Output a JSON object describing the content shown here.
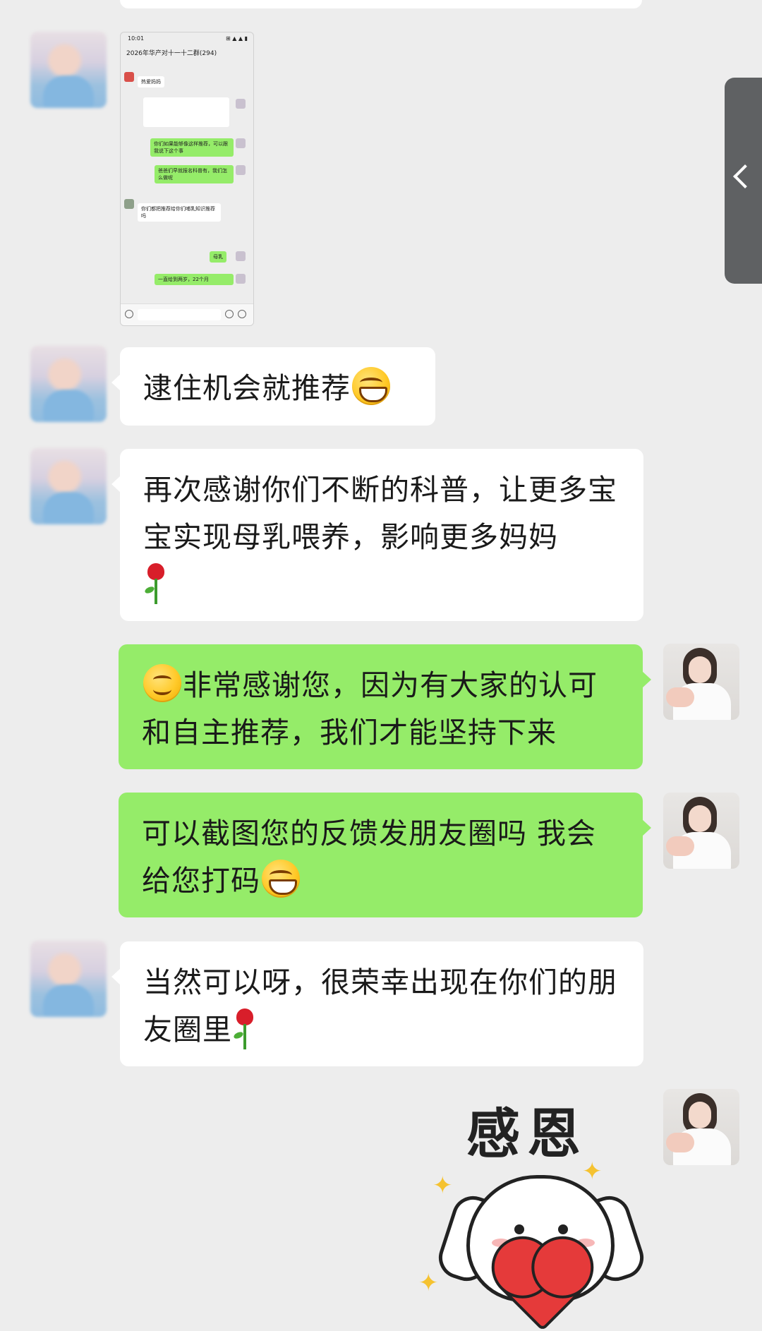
{
  "chat": {
    "thumbnail": {
      "status_time": "10:01",
      "status_right": "⊞ ▲ ▲ ▮",
      "title": "2026年华产对十一十二群(294)",
      "lines": [
        "热爱妈妈",
        "你们如果能够像这样推荐，可以跟我说下这个事",
        "爸爸们早就报名科普有，我们怎么做呢",
        "你们都把推荐给你们哺乳知识推荐吗",
        "母乳",
        "一直给到两岁，22个月"
      ]
    },
    "messages": [
      {
        "text": "逮住机会就推荐"
      },
      {
        "text": "再次感谢你们不断的科普，让更多宝宝实现母乳喂养，影响更多妈妈"
      },
      {
        "text": "非常感谢您，因为有大家的认可和自主推荐，我们才能坚持下来"
      },
      {
        "text": "可以截图您的反馈发朋友圈吗 我会给您打码"
      },
      {
        "text": "当然可以呀，很荣幸出现在你们的朋友圈里"
      }
    ],
    "sticker": {
      "text": "感恩"
    }
  },
  "colors": {
    "background": "#ededed",
    "incoming_bubble": "#ffffff",
    "outgoing_bubble": "#95ec69",
    "side_handle": "#5f6163"
  },
  "icons": {
    "side_handle": "chevron-left-icon",
    "emoji_1": "laughing-face-emoji",
    "emoji_2": "rose-emoji",
    "emoji_3": "smiling-face-emoji",
    "emoji_4": "grinning-face-emoji"
  }
}
